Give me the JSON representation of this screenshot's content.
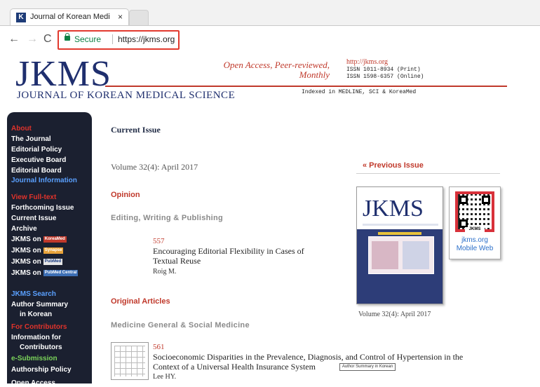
{
  "browser": {
    "tab_title": "Journal of Korean Medi",
    "tab_close": "×",
    "favicon_letter": "K",
    "secure_label": "Secure",
    "url": "https://jkms.org"
  },
  "masthead": {
    "logo": "JKMS",
    "logo_subtitle": "JOURNAL OF KOREAN MEDICAL SCIENCE",
    "tagline_line1": "Open Access, Peer-reviewed,",
    "tagline_line2": "Monthly",
    "site_link": "http://jkms.org",
    "issn_print": "ISSN 1011-8934 (Print)",
    "issn_online": "ISSN 1598-6357 (Online)",
    "indexed": "Indexed in MEDLINE, SCI & KoreaMed"
  },
  "sidebar": {
    "items": [
      {
        "label": "About",
        "style": "red"
      },
      {
        "label": "The Journal",
        "style": "white"
      },
      {
        "label": "Editorial Policy",
        "style": "white"
      },
      {
        "label": "Executive Board",
        "style": "white"
      },
      {
        "label": "Editorial Board",
        "style": "white"
      },
      {
        "label": "Journal Information",
        "style": "blue"
      },
      {
        "label": "View Full-text",
        "style": "red"
      },
      {
        "label": "Forthcoming Issue",
        "style": "white"
      },
      {
        "label": "Current Issue",
        "style": "white"
      },
      {
        "label": "Archive",
        "style": "white"
      },
      {
        "label": "JKMS on",
        "style": "white",
        "badge": "KoreaMed"
      },
      {
        "label": "JKMS on",
        "style": "white",
        "badge": "Synapse"
      },
      {
        "label": "JKMS on",
        "style": "white",
        "badge": "PubMed"
      },
      {
        "label": "JKMS on",
        "style": "white",
        "badge": "PubMed Central"
      },
      {
        "label": "JKMS Search",
        "style": "blue"
      },
      {
        "label": "Author Summary",
        "style": "white"
      },
      {
        "label": "in Korean",
        "style": "white"
      },
      {
        "label": "For Contributors",
        "style": "red"
      },
      {
        "label": "Information for",
        "style": "white"
      },
      {
        "label": "Contributors",
        "style": "white"
      },
      {
        "label": "e-Submission",
        "style": "green"
      },
      {
        "label": "Authorship Policy",
        "style": "white"
      },
      {
        "label": "Open Access",
        "style": "white"
      }
    ]
  },
  "main": {
    "heading": "Current Issue",
    "volume": "Volume 32(4): April 2017",
    "sections": {
      "opinion": "Opinion",
      "editing": "Editing, Writing & Publishing",
      "original": "Original Articles",
      "medicine": "Medicine General & Social Medicine"
    },
    "articles": [
      {
        "number": "557",
        "title_line1": "Encouraging Editorial Flexibility in Cases of",
        "title_line2": "Textual Reuse",
        "author": "Roig M."
      },
      {
        "number": "561",
        "title_line1": "Socioeconomic Disparities in the Prevalence, Diagnosis, and Control of Hypertension in the",
        "title_line2": "Context of a Universal Health Insurance System",
        "author": "Lee HY.",
        "summary_button": "Author Summary in Korean"
      }
    ]
  },
  "right": {
    "previous_issue": "« Previous Issue",
    "cover_logo": "JKMS",
    "qr_label": "JKMS",
    "qr_url": "jkms.org",
    "qr_caption": "Mobile Web",
    "cover_caption": "Volume 32(4): April 2017"
  }
}
